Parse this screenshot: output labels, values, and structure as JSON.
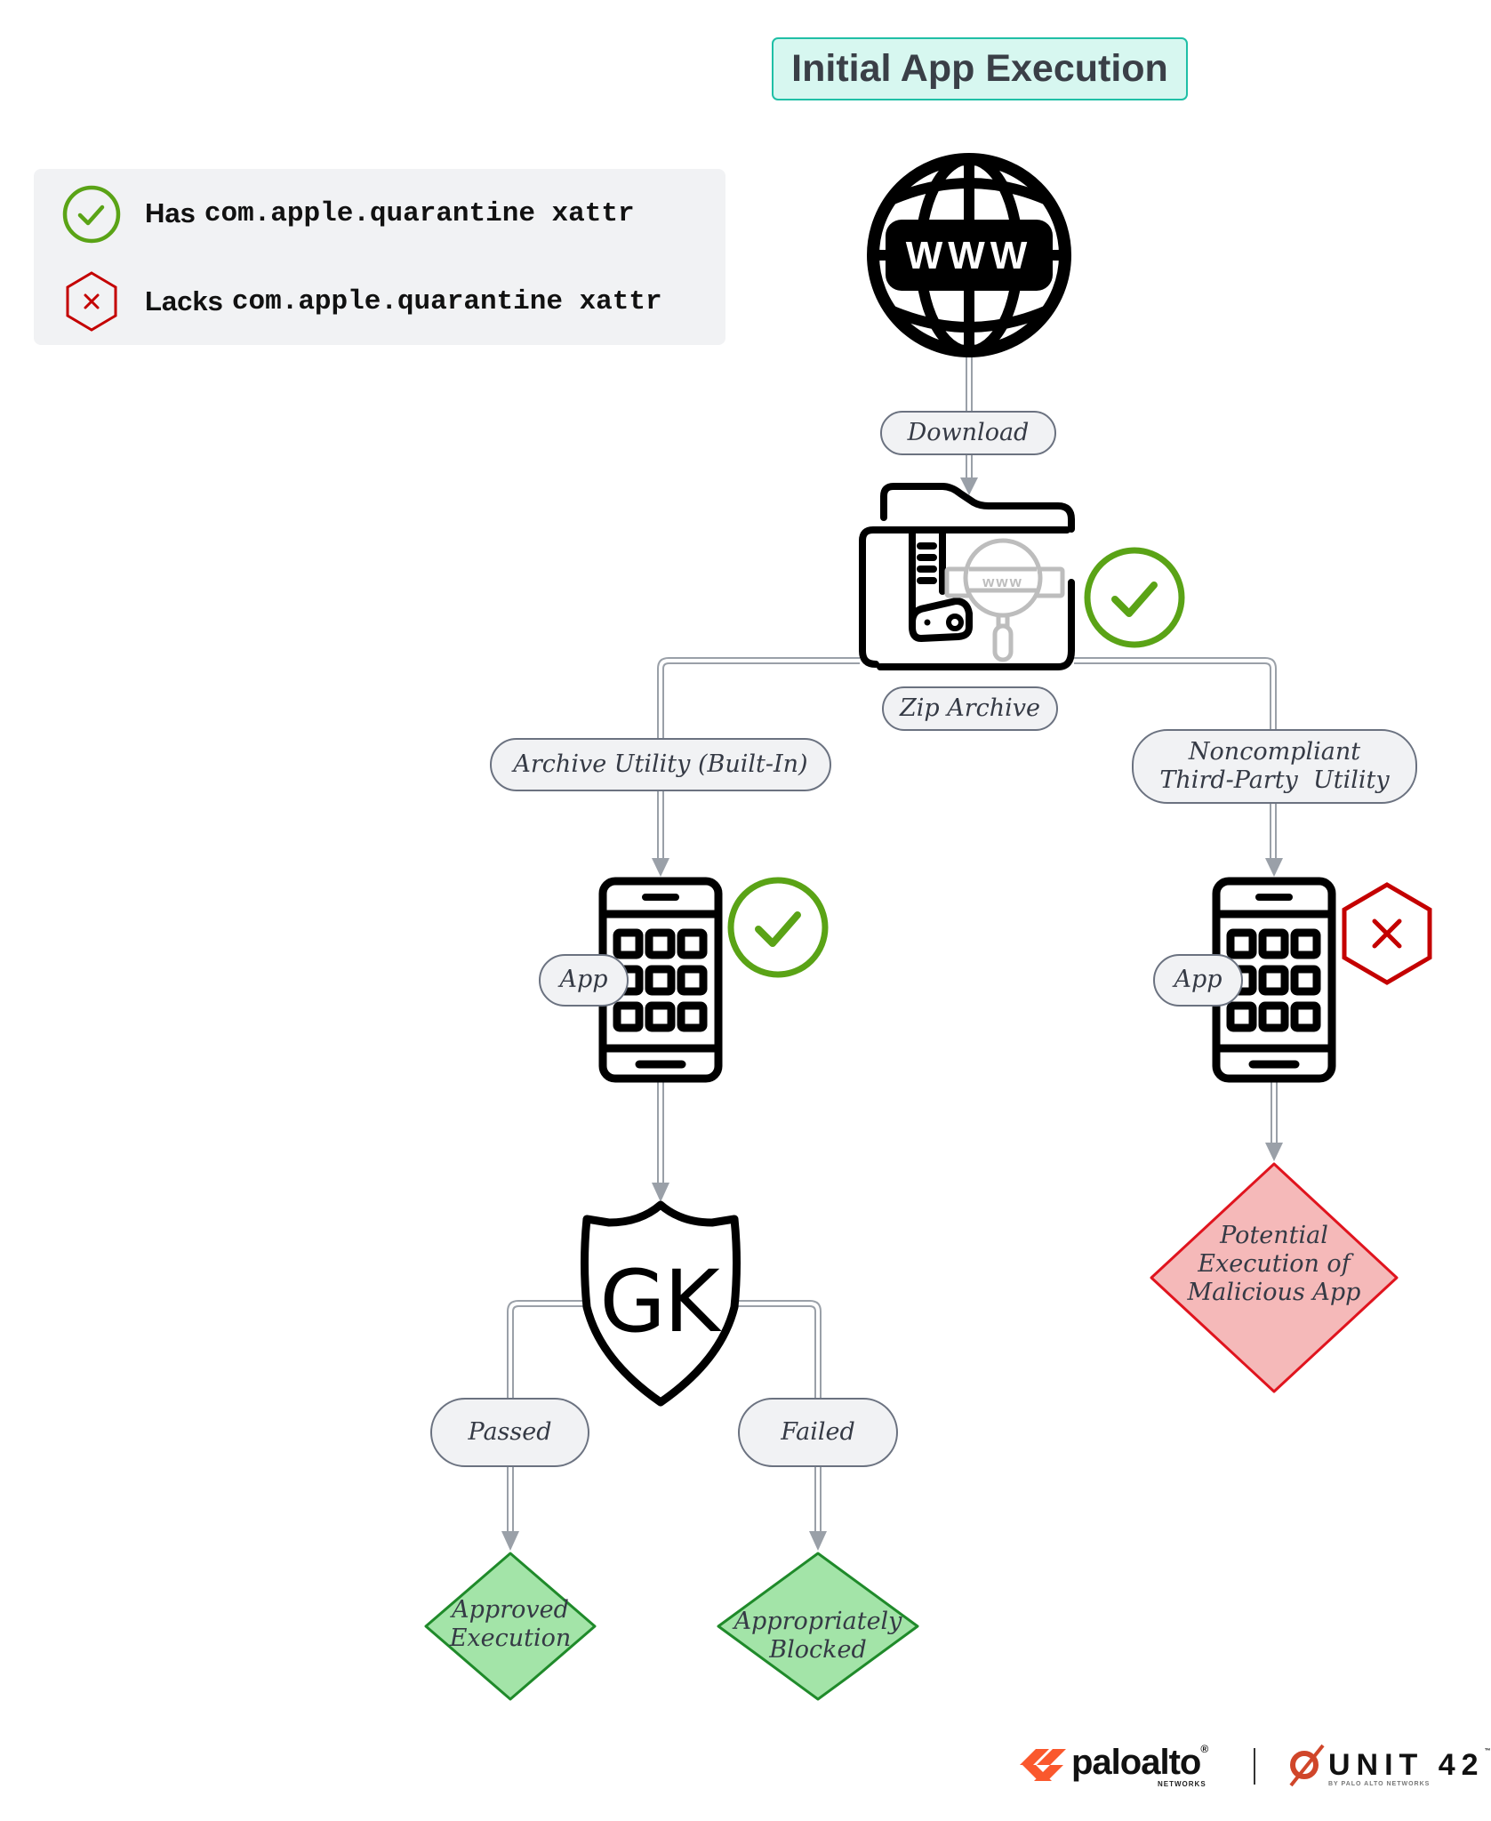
{
  "title": "Initial App Execution",
  "colors": {
    "title_fill": "#d7f7f0",
    "title_border": "#1fbfa6",
    "check_green": "#5aa316",
    "cross_red": "#c40000",
    "connector_gray": "#9aa0a8",
    "pill_fill": "#f1f2f4",
    "pill_border": "#6b7280",
    "success_fill": "#a3e4a8",
    "success_border": "#1f8a2a",
    "danger_fill": "#f5b9b9",
    "danger_border": "#e0141e",
    "brand_orange": "#fa582d"
  },
  "legend": {
    "items": [
      {
        "icon": "check-circle-icon",
        "prefix": "Has",
        "code": "com.apple.quarantine xattr"
      },
      {
        "icon": "cross-hexagon-icon",
        "prefix": "Lacks",
        "code": "com.apple.quarantine xattr"
      }
    ]
  },
  "nodes": {
    "source": {
      "icon": "www-globe-icon",
      "text": "www"
    },
    "download_label": "Download",
    "archive": {
      "icon": "zip-archive-folder-icon",
      "label": "Zip Archive",
      "status": "has-quarantine"
    },
    "branch_left_label": "Archive Utility (Built-In)",
    "branch_right_label_line1": "Noncompliant",
    "branch_right_label_line2": "Third-Party  Utility",
    "app_left": {
      "icon": "smartphone-app-icon",
      "label": "App",
      "status": "has-quarantine"
    },
    "app_right": {
      "icon": "smartphone-app-icon",
      "label": "App",
      "status": "lacks-quarantine"
    },
    "gatekeeper": {
      "icon": "gatekeeper-shield-icon",
      "text": "GK"
    },
    "passed_label": "Passed",
    "failed_label": "Failed",
    "outcome_approved": {
      "line1": "Approved",
      "line2": "Execution"
    },
    "outcome_blocked": {
      "line1": "Appropriately",
      "line2": "Blocked"
    },
    "outcome_malicious": {
      "line1": "Potential",
      "line2": "Execution of",
      "line3": "Malicious App"
    }
  },
  "footer": {
    "paloalto": "paloalto",
    "paloalto_reg": "®",
    "paloalto_sub": "NETWORKS",
    "unit42": "UNIT 42",
    "unit42_tm": "™",
    "unit42_sub": "BY PALO ALTO NETWORKS"
  }
}
